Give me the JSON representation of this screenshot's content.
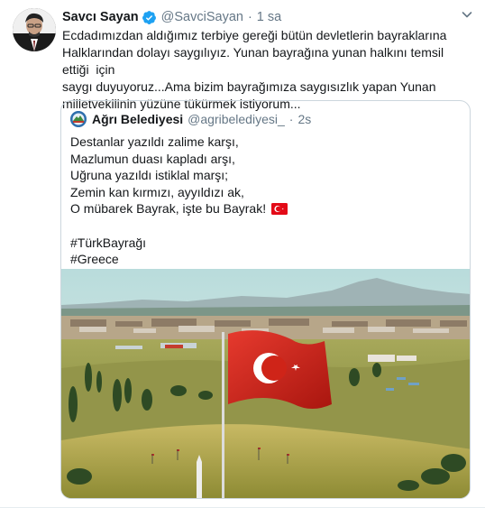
{
  "tweet": {
    "author_name": "Savcı Sayan",
    "author_handle": "@SavciSayan",
    "separator": "·",
    "time": "1 sa",
    "text": "Ecdadımızdan aldığımız terbiye gereği bütün devletlerin bayraklarına\nHalklarından dolayı saygılıyız. Yunan bayrağına yunan halkını temsil ettiği  için\nsaygı duyuyoruz...Ama bizim bayrağımıza saygısızlık yapan Yunan\nmilletvekilinin yüzüne tükürmek istiyorum..."
  },
  "quoted_tweet": {
    "author_name": "Ağrı Belediyesi",
    "author_handle": "@agribelediyesi_",
    "separator": "·",
    "time": "2s",
    "lines": [
      "Destanlar yazıldı zalime karşı,",
      "Mazlumun duası kapladı arşı,",
      "Uğruna yazıldı istiklal marşı;",
      "Zemin kan kırmızı, ayyıldızı ak,",
      "O mübarek Bayrak, işte bu Bayrak!",
      "",
      "#TürkBayrağı",
      "#Greece"
    ]
  },
  "colors": {
    "text": "#14171a",
    "secondary": "#657786",
    "verified": "#1da1f2",
    "flag_red": "#e30a17",
    "border": "#ccd6dd"
  },
  "icons": [
    "verified-badge-icon",
    "caret-down-icon",
    "turkish-flag-icon"
  ]
}
